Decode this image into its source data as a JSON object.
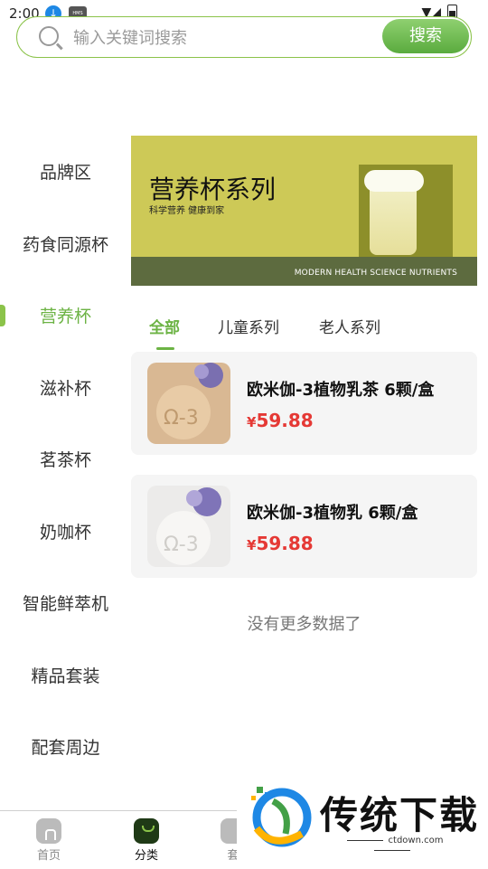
{
  "status": {
    "time": "2:00",
    "hms_label": "HMS"
  },
  "search": {
    "placeholder": "输入关键词搜索",
    "button_label": "搜索"
  },
  "sidebar": {
    "items": [
      {
        "label": "品牌区"
      },
      {
        "label": "药食同源杯"
      },
      {
        "label": "营养杯"
      },
      {
        "label": "滋补杯"
      },
      {
        "label": "茗茶杯"
      },
      {
        "label": "奶咖杯"
      },
      {
        "label": "智能鲜萃机"
      },
      {
        "label": "精品套装"
      },
      {
        "label": "配套周边"
      }
    ],
    "active_index": 2
  },
  "banner": {
    "title": "营养杯系列",
    "subtitle": "科学营养 健康到家",
    "strip_text": "MODERN HEALTH SCIENCE NUTRIENTS"
  },
  "tabs": [
    {
      "label": "全部"
    },
    {
      "label": "儿童系列"
    },
    {
      "label": "老人系列"
    }
  ],
  "products": [
    {
      "name": "欧米伽-3植物乳茶 6颗/盒",
      "currency": "¥",
      "price": "59.88",
      "image_text": "Ω-3"
    },
    {
      "name": "欧米伽-3植物乳 6颗/盒",
      "currency": "¥",
      "price": "59.88",
      "image_text": "Ω-3"
    }
  ],
  "list_end_text": "没有更多数据了",
  "bottom_nav": [
    {
      "label": "首页",
      "icon": "home-icon"
    },
    {
      "label": "分类",
      "icon": "category-icon"
    },
    {
      "label": "套",
      "icon": "package-icon"
    }
  ],
  "watermark": {
    "text": "传统下载",
    "url": "ctdown.com"
  },
  "colors": {
    "accent": "#6cb344",
    "price": "#e53935",
    "banner_bg": "#cdc957"
  }
}
